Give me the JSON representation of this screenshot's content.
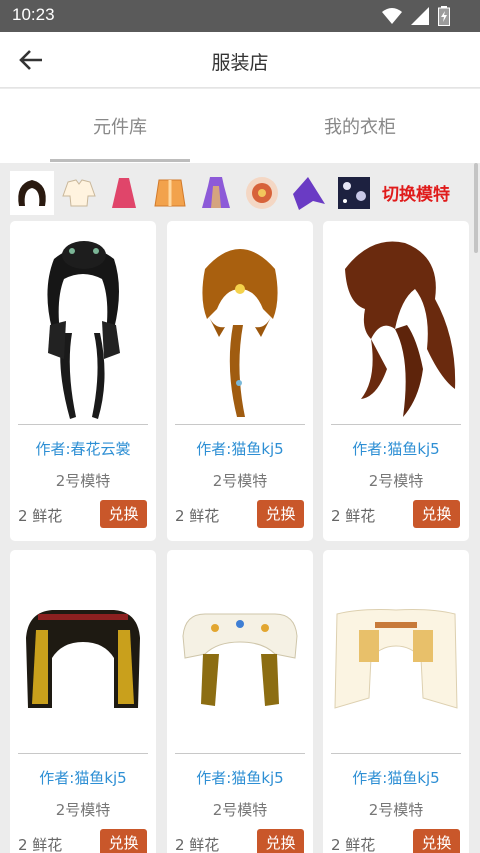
{
  "status": {
    "time": "10:23"
  },
  "header": {
    "title": "服装店"
  },
  "tabs": [
    {
      "label": "元件库"
    },
    {
      "label": "我的衣柜"
    }
  ],
  "category_bar": {
    "icons": [
      "hair-icon",
      "blouse-icon",
      "skirt-icon",
      "jacket-icon",
      "dress-icon",
      "flower-icon",
      "cape-icon",
      "background-icon"
    ],
    "switch_label": "切换模特"
  },
  "items": [
    {
      "author": "作者:春花云裳",
      "model": "2号模特",
      "price": "2 鲜花",
      "button": "兑换"
    },
    {
      "author": "作者:猫鱼kj5",
      "model": "2号模特",
      "price": "2 鲜花",
      "button": "兑换"
    },
    {
      "author": "作者:猫鱼kj5",
      "model": "2号模特",
      "price": "2 鲜花",
      "button": "兑换"
    },
    {
      "author": "作者:猫鱼kj5",
      "model": "2号模特",
      "price": "2 鲜花",
      "button": "兑换"
    },
    {
      "author": "作者:猫鱼kj5",
      "model": "2号模特",
      "price": "2 鲜花",
      "button": "兑换"
    },
    {
      "author": "作者:猫鱼kj5",
      "model": "2号模特",
      "price": "2 鲜花",
      "button": "兑换"
    }
  ],
  "colors": {
    "accent": "#c9572a",
    "author": "#2e8fd4",
    "switch": "#e01b1b"
  }
}
